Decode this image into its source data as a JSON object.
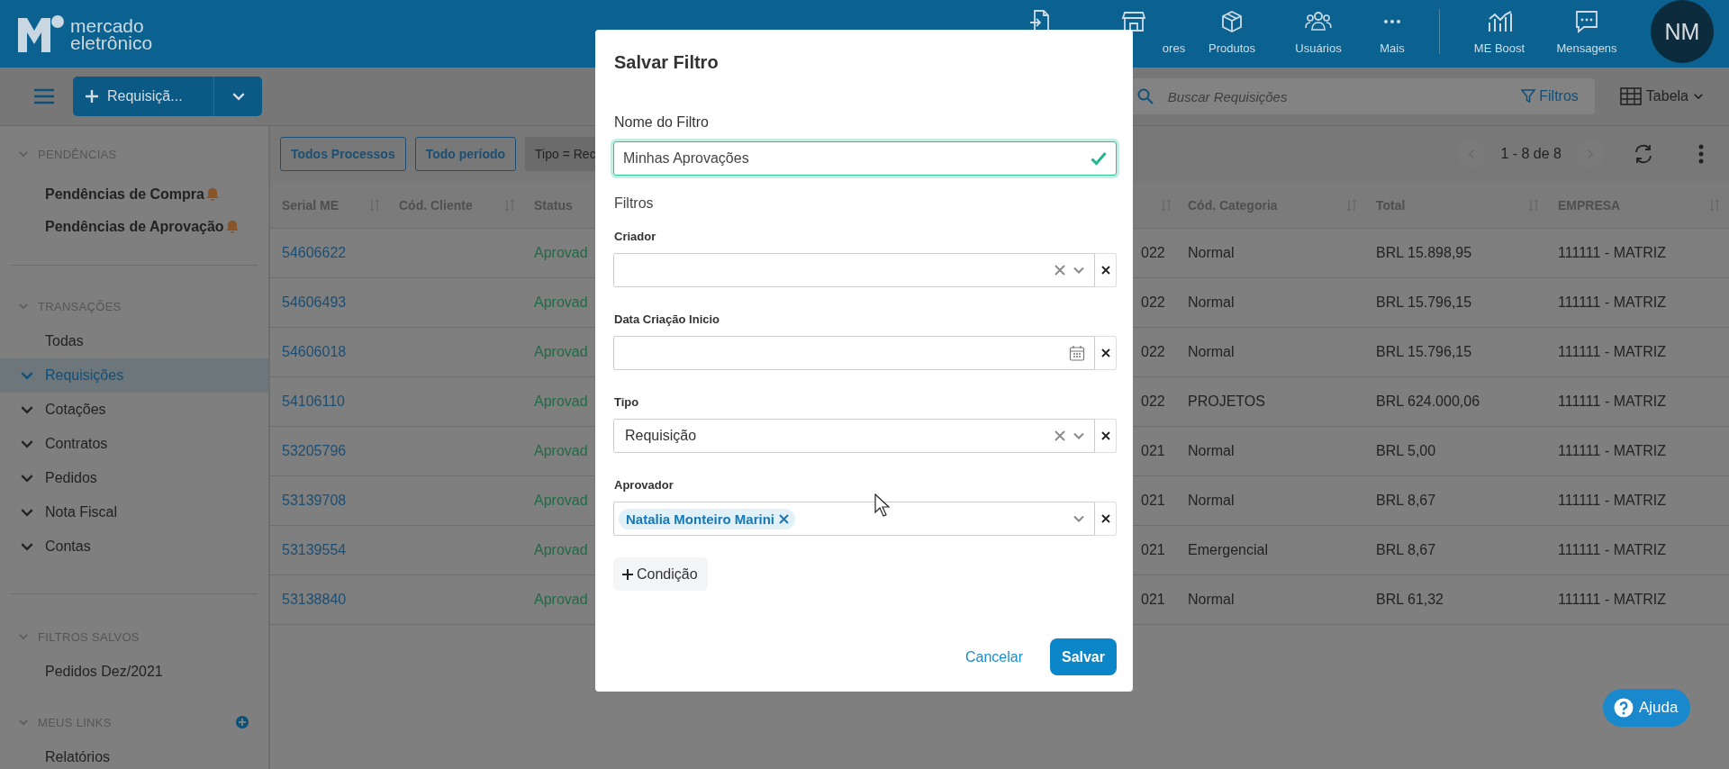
{
  "header": {
    "logo": {
      "line1": "mercado",
      "line2": "eletrônico"
    },
    "nav": [
      {
        "label": "ores"
      },
      {
        "label": "Produtos"
      },
      {
        "label": "Usuários"
      },
      {
        "label": "Mais"
      },
      {
        "label": "ME Boost"
      },
      {
        "label": "Mensagens"
      }
    ],
    "avatar": {
      "initials": "NM"
    }
  },
  "toolbar": {
    "new_button": {
      "label": "Requisiçã..."
    },
    "search": {
      "placeholder": "Buscar Requisições"
    },
    "filters_button": "Filtros",
    "view_button": "Tabela"
  },
  "sidebar": {
    "sections": [
      {
        "title": "PENDÊNCIAS",
        "items": [
          {
            "label": "Pendências de Compra",
            "kind": "alert",
            "selected": false
          },
          {
            "label": "Pendências de Aprovação",
            "kind": "alert",
            "selected": false
          }
        ]
      },
      {
        "title": "TRANSAÇÕES",
        "items": [
          {
            "label": "Todas",
            "kind": "link",
            "selected": false
          },
          {
            "label": "Requisições",
            "kind": "group",
            "selected": true
          },
          {
            "label": "Cotações",
            "kind": "group",
            "selected": false
          },
          {
            "label": "Contratos",
            "kind": "group",
            "selected": false
          },
          {
            "label": "Pedidos",
            "kind": "group",
            "selected": false
          },
          {
            "label": "Nota Fiscal",
            "kind": "group",
            "selected": false
          },
          {
            "label": "Contas",
            "kind": "group",
            "selected": false
          }
        ]
      },
      {
        "title": "FILTROS SALVOS",
        "addable": false,
        "items": [
          {
            "label": "Pedidos Dez/2021",
            "kind": "link",
            "selected": false
          }
        ]
      },
      {
        "title": "MEUS LINKS",
        "addable": true,
        "items": [
          {
            "label": "Relatórios",
            "kind": "link",
            "selected": false
          }
        ]
      }
    ]
  },
  "chips": [
    {
      "label": "Todos Processos",
      "kind": "outline"
    },
    {
      "label": "Todo período",
      "kind": "outline"
    },
    {
      "label": "Tipo = Rec",
      "kind": "filled"
    }
  ],
  "pager": {
    "range": "1 - 8 de 8"
  },
  "table": {
    "columns": [
      {
        "label": "Serial ME",
        "sortable": true
      },
      {
        "label": "Cód. Cliente",
        "sortable": true
      },
      {
        "label": "Status",
        "sortable": false
      },
      {
        "sortable": true
      },
      {
        "label": "Cód. Categoria",
        "sortable": true
      },
      {
        "label": "Total",
        "sortable": true
      },
      {
        "label": "EMPRESA",
        "sortable": true
      }
    ],
    "rows": [
      {
        "serial_me": "54606622",
        "status": "Aprovad",
        "column_4": "022",
        "cod_categoria": "Normal",
        "total": "BRL 15.898,95",
        "empresa": "111111 - MATRIZ"
      },
      {
        "serial_me": "54606493",
        "status": "Aprovad",
        "column_4": "022",
        "cod_categoria": "Normal",
        "total": "BRL 15.796,15",
        "empresa": "111111 - MATRIZ"
      },
      {
        "serial_me": "54606018",
        "status": "Aprovad",
        "column_4": "022",
        "cod_categoria": "Normal",
        "total": "BRL 15.796,15",
        "empresa": "111111 - MATRIZ"
      },
      {
        "serial_me": "54106110",
        "status": "Aprovad",
        "column_4": "022",
        "cod_categoria": "PROJETOS",
        "total": "BRL 624.000,06",
        "empresa": "111111 - MATRIZ"
      },
      {
        "serial_me": "53205796",
        "status": "Aprovad",
        "column_4": "021",
        "cod_categoria": "Normal",
        "total": "BRL 5,00",
        "empresa": "111111 - MATRIZ"
      },
      {
        "serial_me": "53139708",
        "status": "Aprovad",
        "column_4": "021",
        "cod_categoria": "Normal",
        "total": "BRL 8,67",
        "empresa": "111111 - MATRIZ"
      },
      {
        "serial_me": "53139554",
        "status": "Aprovad",
        "column_4": "021",
        "cod_categoria": "Emergencial",
        "total": "BRL 8,67",
        "empresa": "111111 - MATRIZ"
      },
      {
        "serial_me": "53138840",
        "status": "Aprovad",
        "column_4": "021",
        "cod_categoria": "Normal",
        "total": "BRL 61,32",
        "empresa": "111111 - MATRIZ"
      }
    ]
  },
  "modal": {
    "title": "Salvar Filtro",
    "name_label": "Nome do Filtro",
    "name_value": "Minhas Aprovações",
    "name_valid": true,
    "filters_label": "Filtros",
    "fields": [
      {
        "label": "Criador",
        "kind": "select",
        "clearable": true
      },
      {
        "label": "Data Criação Inicio",
        "kind": "date",
        "clearable": false
      },
      {
        "label": "Tipo",
        "kind": "select",
        "clearable": true,
        "value": "Requisição"
      },
      {
        "label": "Aprovador",
        "kind": "multiselect",
        "clearable": false,
        "tags": [
          "Natalia Monteiro Marini"
        ]
      }
    ],
    "add_condition": "Condição",
    "cancel": "Cancelar",
    "save": "Salvar"
  },
  "help": {
    "label": "Ajuda"
  }
}
